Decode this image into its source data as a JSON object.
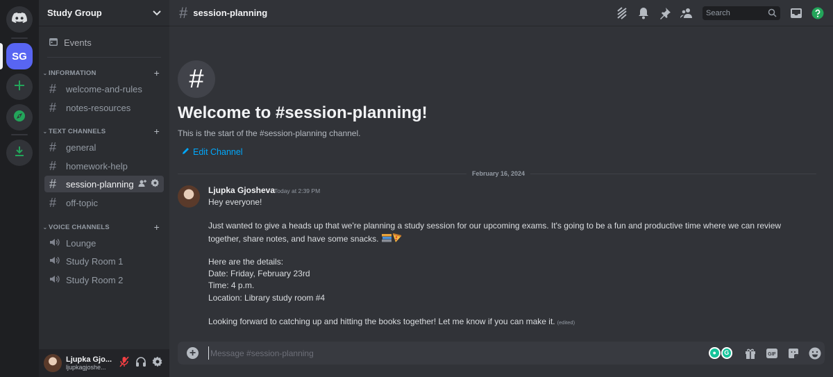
{
  "servers": {
    "home_icon": "discord-logo-icon",
    "study_group_abbrev": "SG",
    "add_icon": "plus-icon",
    "discover_icon": "compass-icon",
    "download_icon": "download-icon"
  },
  "sidebar": {
    "guild_name": "Study Group",
    "events_label": "Events",
    "categories": [
      {
        "name": "INFORMATION",
        "channels": [
          "welcome-and-rules",
          "notes-resources"
        ]
      },
      {
        "name": "TEXT CHANNELS",
        "channels": [
          "general",
          "homework-help",
          "session-planning",
          "off-topic"
        ]
      },
      {
        "name": "VOICE CHANNELS",
        "channels": [
          "Lounge",
          "Study Room 1",
          "Study Room 2"
        ]
      }
    ],
    "active_channel": "session-planning"
  },
  "user_panel": {
    "display_name": "Ljupka Gjo...",
    "username": "ljupkagjoshe..."
  },
  "topbar": {
    "channel_name": "session-planning",
    "search_placeholder": "Search"
  },
  "welcome": {
    "title": "Welcome to #session-planning!",
    "subtitle": "This is the start of the #session-planning channel.",
    "edit_label": "Edit Channel"
  },
  "messages": {
    "date_divider": "February 16, 2024",
    "author": "Ljupka Gjosheva",
    "timestamp": "Today at 2:39 PM",
    "lines": [
      "Hey everyone!",
      "Just wanted to give a heads up that we're planning a study session for our upcoming exams. It's going to be a fun and productive time where we can review",
      "together, share notes, and have some snacks.",
      "Here are the details:",
      "Date: Friday, February 23rd",
      "Time: 4 p.m.",
      "Location: Library study room #4",
      "Looking forward to catching up and hitting the books together! Let me know if you can make it."
    ],
    "edited_label": "(edited)"
  },
  "composer": {
    "placeholder": "Message #session-planning"
  },
  "colors": {
    "accent": "#5865f2",
    "green": "#23a55a",
    "link": "#00a8fc",
    "bg": "#313338"
  }
}
